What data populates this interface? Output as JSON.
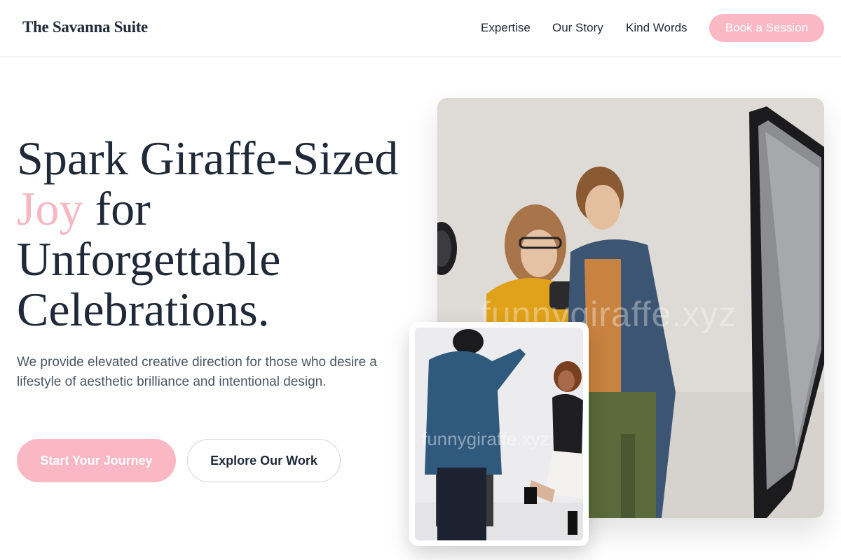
{
  "header": {
    "brand": "The Savanna Suite",
    "nav": [
      "Expertise",
      "Our Story",
      "Kind Words"
    ],
    "cta": "Book a Session"
  },
  "hero": {
    "headline_before": "Spark Giraffe-Sized ",
    "headline_accent": "Joy",
    "headline_after": " for Unforgettable Celebrations.",
    "subtext": "We provide elevated creative direction for those who desire a lifestyle of aesthetic brilliance and intentional design.",
    "primary_button": "Start Your Journey",
    "secondary_button": "Explore Our Work"
  },
  "images": {
    "main_watermark": "funnygiraffe.xyz",
    "small_watermark": "funnygiraffe.xyz",
    "main_alt": "photo-studio-couple-camera",
    "small_alt": "photographer-shooting-dancer"
  },
  "colors": {
    "accent_pink": "#f9b8c4",
    "text_dark": "#1f2937",
    "text_muted": "#4b5563"
  }
}
